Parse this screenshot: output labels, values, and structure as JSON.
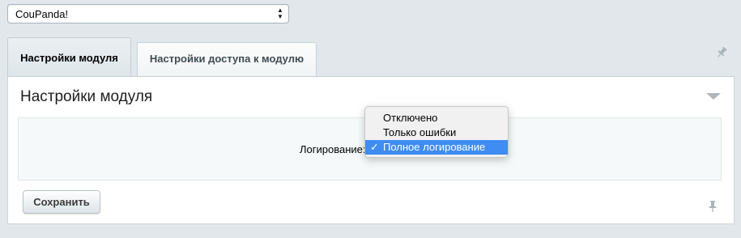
{
  "module_select": {
    "value": "CouPanda!"
  },
  "tabs": [
    {
      "label": "Настройки модуля",
      "active": true
    },
    {
      "label": "Настройки доступа к модулю",
      "active": false
    }
  ],
  "panel": {
    "title": "Настройки модуля",
    "field_label": "Логирование:",
    "save_label": "Сохранить"
  },
  "dropdown": {
    "options": [
      "Отключено",
      "Только ошибки",
      "Полное логирование"
    ],
    "selected": "Полное логирование",
    "check_glyph": "✓"
  },
  "colors": {
    "background": "#e1e7eb",
    "selected_option": "#3f8cf3"
  },
  "icons": [
    "chevron-updown-icon",
    "pin-icon",
    "collapse-arrow-icon",
    "checkmark-icon"
  ]
}
